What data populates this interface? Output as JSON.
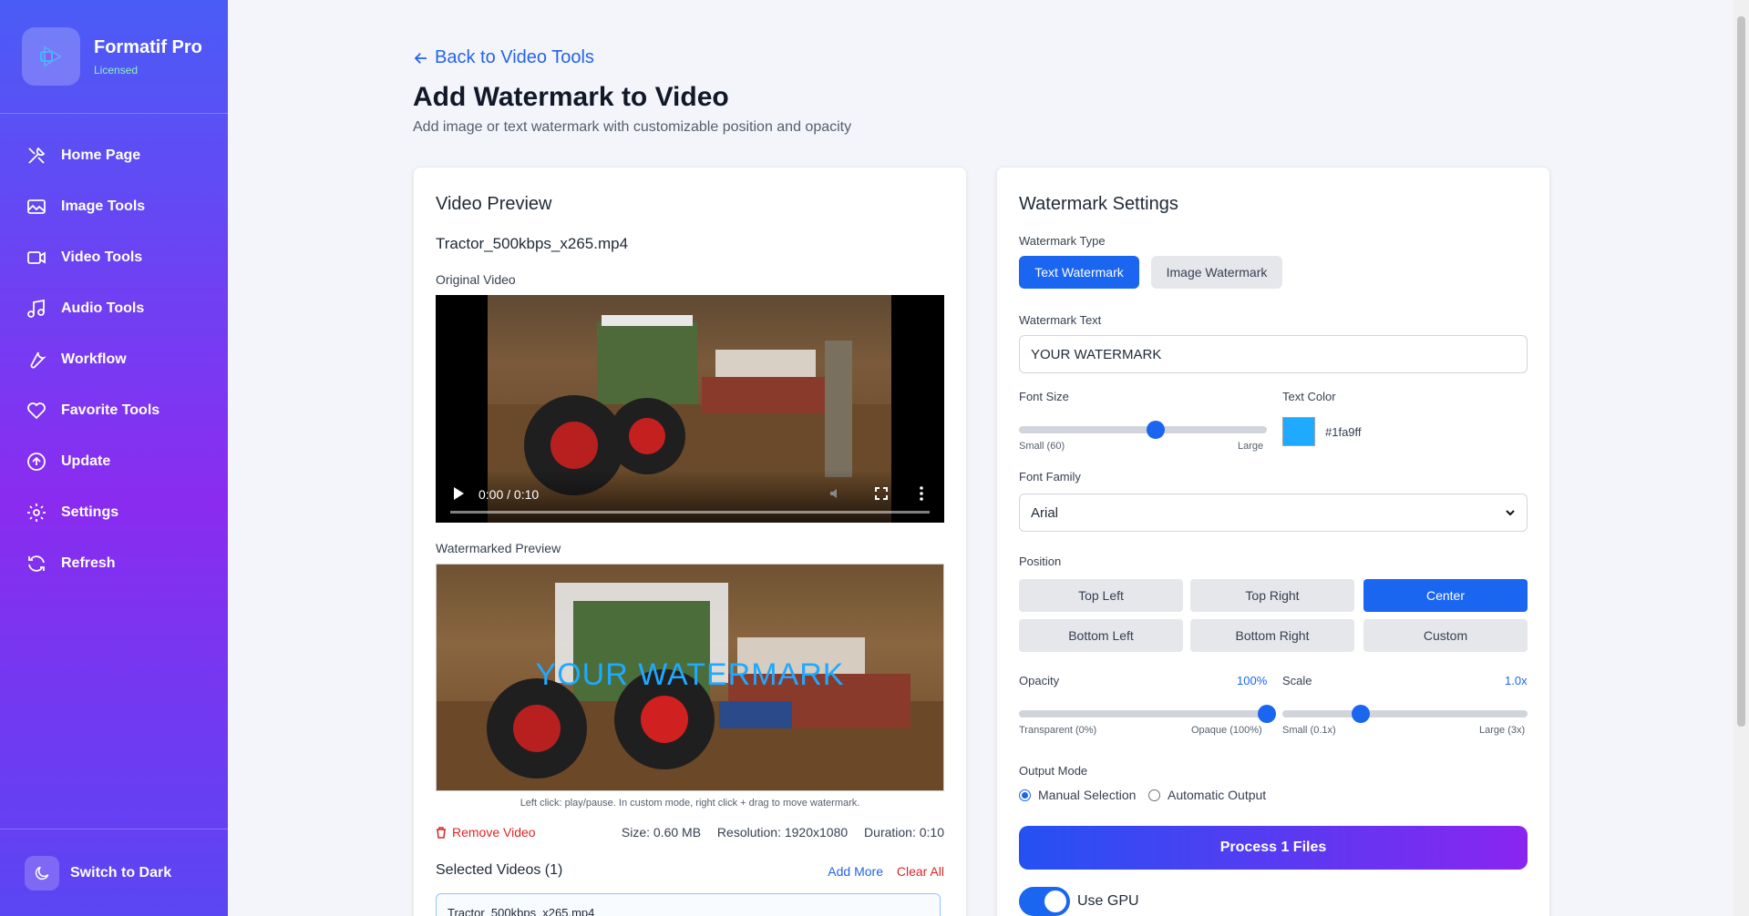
{
  "app": {
    "name": "Formatif Pro",
    "license_status": "Licensed"
  },
  "sidebar": {
    "items": [
      {
        "label": "Home Page",
        "icon": "tools-icon"
      },
      {
        "label": "Image Tools",
        "icon": "image-icon"
      },
      {
        "label": "Video Tools",
        "icon": "video-icon"
      },
      {
        "label": "Audio Tools",
        "icon": "music-icon"
      },
      {
        "label": "Workflow",
        "icon": "wrench-icon"
      },
      {
        "label": "Favorite Tools",
        "icon": "heart-icon"
      },
      {
        "label": "Update",
        "icon": "upload-icon"
      },
      {
        "label": "Settings",
        "icon": "gear-icon"
      },
      {
        "label": "Refresh",
        "icon": "refresh-icon"
      }
    ],
    "theme_toggle_label": "Switch to Dark"
  },
  "header": {
    "back_label": "Back to Video Tools",
    "title": "Add Watermark to Video",
    "subtitle": "Add image or text watermark with customizable position and opacity"
  },
  "preview": {
    "title": "Video Preview",
    "file_name": "Tractor_500kbps_x265.mp4",
    "original_label": "Original Video",
    "player_time": "0:00 / 0:10",
    "progress": 0.0,
    "watermarked_label": "Watermarked Preview",
    "watermark_overlay_text": "YOUR WATERMARK",
    "hint": "Left click: play/pause. In custom mode, right click + drag to move watermark.",
    "remove_label": "Remove Video",
    "size": "Size: 0.60 MB",
    "resolution": "Resolution: 1920x1080",
    "duration": "Duration: 0:10",
    "selected_title": "Selected Videos (1)",
    "add_more": "Add More",
    "clear_all": "Clear All",
    "selected_files": [
      "Tractor_500kbps_x265.mp4"
    ]
  },
  "settings": {
    "title": "Watermark Settings",
    "type_label": "Watermark Type",
    "type_options": [
      "Text Watermark",
      "Image Watermark"
    ],
    "type_selected": "Text Watermark",
    "text_label": "Watermark Text",
    "text_value": "YOUR WATERMARK",
    "font_size_label": "Font Size",
    "font_size_min_label": "Small (60)",
    "font_size_max_label": "Large",
    "font_size_level": 0.55,
    "text_color_label": "Text Color",
    "text_color": "#1fa9ff",
    "font_family_label": "Font Family",
    "font_family_value": "Arial",
    "position_label": "Position",
    "positions": [
      "Top Left",
      "Top Right",
      "Center",
      "Bottom Left",
      "Bottom Right",
      "Custom"
    ],
    "position_selected": "Center",
    "opacity_label": "Opacity",
    "opacity_value": "100%",
    "opacity_level": 1.0,
    "opacity_min_label": "Transparent (0%)",
    "opacity_max_label": "Opaque (100%)",
    "scale_label": "Scale",
    "scale_value": "1.0x",
    "scale_level": 0.32,
    "scale_min_label": "Small (0.1x)",
    "scale_max_label": "Large (3x)",
    "output_mode_label": "Output Mode",
    "output_modes": [
      "Manual Selection",
      "Automatic Output"
    ],
    "output_mode_selected": "Manual Selection",
    "process_label": "Process 1 Files",
    "gpu_label": "Use GPU",
    "gpu_enabled": true
  },
  "colors": {
    "accent": "#1a66f0",
    "danger": "#dc2626",
    "sidebar_top": "#4a5cf6",
    "sidebar_mid": "#8a2cf0"
  }
}
